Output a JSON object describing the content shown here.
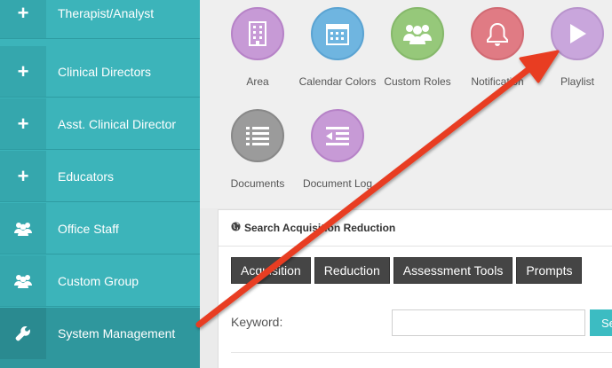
{
  "sidebar": {
    "items": [
      {
        "label": "Therapist/Analyst",
        "icon": "plus-icon"
      },
      {
        "label": "Clinical Directors",
        "icon": "plus-icon"
      },
      {
        "label": "Asst. Clinical Director",
        "icon": "plus-icon"
      },
      {
        "label": "Educators",
        "icon": "plus-icon"
      },
      {
        "label": "Office Staff",
        "icon": "users-icon"
      },
      {
        "label": "Custom Group",
        "icon": "users-icon"
      },
      {
        "label": "System Management",
        "icon": "wrench-icon"
      }
    ]
  },
  "tiles": [
    {
      "label": "Area",
      "color": "#c79ad6",
      "icon": "building-icon"
    },
    {
      "label": "Calendar Colors",
      "color": "#6fb5e0",
      "icon": "calendar-icon"
    },
    {
      "label": "Custom Roles",
      "color": "#96c87a",
      "icon": "users-icon"
    },
    {
      "label": "Notification",
      "color": "#e07b84",
      "icon": "bell-icon"
    },
    {
      "label": "Playlist",
      "color": "#c9a6dc",
      "icon": "play-icon"
    },
    {
      "label": "Documents",
      "color": "#9b9b9b",
      "icon": "list-icon"
    },
    {
      "label": "Document Log",
      "color": "#c79ad6",
      "icon": "log-icon"
    }
  ],
  "search_panel": {
    "title": "Search Acquisition Reduction",
    "tabs": [
      "Acquisition",
      "Reduction",
      "Assessment Tools",
      "Prompts"
    ],
    "keyword_label": "Keyword:",
    "keyword_value": "",
    "go_label": "Se"
  },
  "colors": {
    "sidebar": "#3cb4ba",
    "arrow": "#e83c23"
  }
}
